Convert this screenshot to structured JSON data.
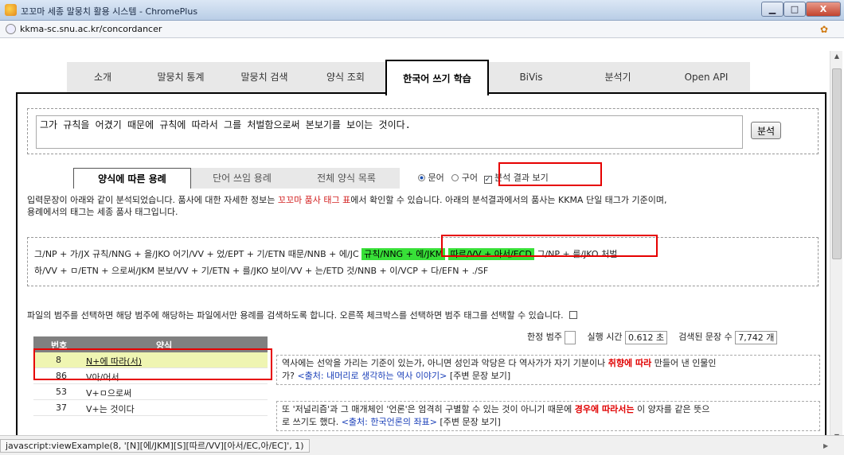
{
  "window": {
    "title": "꼬꼬마 세종 말뭉치 활용 시스템 - ChromePlus",
    "min_glyph": "▁",
    "max_glyph": "□",
    "close_glyph": "X"
  },
  "address": {
    "url": "kkma-sc.snu.ac.kr/concordancer"
  },
  "nav": {
    "tabs": [
      {
        "label": "소개"
      },
      {
        "label": "말뭉치 통계"
      },
      {
        "label": "말뭉치 검색"
      },
      {
        "label": "양식 조회"
      },
      {
        "label": "한국어 쓰기 학습",
        "active": true
      },
      {
        "label": "BiVis"
      },
      {
        "label": "분석기"
      },
      {
        "label": "Open API"
      }
    ]
  },
  "input": {
    "sentence": "그가 규칙을 어겼기 때문에 규칙에 따라서 그를 처벌함으로써 본보기를 보이는 것이다.",
    "analyze_label": "분석"
  },
  "subtabs": [
    {
      "label": "양식에 따른 용례",
      "active": true
    },
    {
      "label": "단어 쓰임 용례"
    },
    {
      "label": "전체 양식 목록"
    }
  ],
  "options": {
    "written": "문어",
    "spoken": "구어",
    "show_result": "분석 결과 보기",
    "selected": "written",
    "show_result_checked": true
  },
  "info": {
    "part1": "입력문장이 아래와 같이 분석되었습니다. 품사에 대한 자세한 정보는 ",
    "link": "꼬꼬마 품사 태그 표",
    "part2": "에서 확인할 수 있습니다. 아래의 분석결과에서의 품사는 KKMA 단일 태그가 기준이며,",
    "line2": "용례에서의 태그는 세종 품사 태그입니다."
  },
  "analysis": {
    "line1_a": "그/NP + 가/JX   규칙/NNG + 을/JKO   어기/VV + 었/EPT + 기/ETN   때문/NNB + 에/JC",
    "hl1": "규칙/NNG + 에/JKM",
    "hl2": "따르/VV + 아서/ECD",
    "line1_b": "그/NP + 를/JKO   처벌",
    "line2": "하/VV + ㅁ/ETN + 으로써/JKM   본보/VV + 기/ETN + 를/JKO   보이/VV + 는/ETD   것/NNB + 이/VCP + 다/EFN + ./SF"
  },
  "filter": {
    "text": "파일의 범주를 선택하면 해당 범주에 해당하는 파일에서만 용례를 검색하도록 합니다. 오른쪽 체크박스를 선택하면 범주 태그를 선택할 수 있습니다."
  },
  "meta": {
    "category_label": "한정 범주",
    "category_value": "",
    "time_label": "실행 시간",
    "time_value": "0.612 초",
    "count_label": "검색된 문장 수",
    "count_value": "7,742 개"
  },
  "table": {
    "headers": {
      "num": "번호",
      "pattern": "양식"
    },
    "rows": [
      {
        "num": "8",
        "pattern": "N+에 따라(서)",
        "selected": true
      },
      {
        "num": "86",
        "pattern": "V아/어서"
      },
      {
        "num": "53",
        "pattern": "V+ㅁ으로써"
      },
      {
        "num": "37",
        "pattern": "V+는 것이다"
      }
    ]
  },
  "examples": [
    {
      "pre": "역사에는 선악을 가리는 기준이 있는가, 아니면 성인과 악당은 다 역사가가 자기 기분이나 ",
      "kw": "취향에 따라",
      "post": " 만들어 낸 인물인",
      "line2_pre": "가? ",
      "src": "<출처: 내머리로 생각하는 역사 이야기>",
      "more": " [주변 문장 보기]"
    },
    {
      "pre": "또 '저널리즘'과 그 매개체인 '언론'은 엄격히 구별할 수 있는 것이 아니기 때문에 ",
      "kw": "경우에 따라서는",
      "post": " 이 양자를 같은 뜻으",
      "line2_pre": "로 쓰기도 했다. ",
      "src": "<출처: 한국언론의 좌표>",
      "more": " [주변 문장 보기]"
    }
  ],
  "status": {
    "text": "javascript:viewExample(8, '[N][에/JKM][S][따르/VV][아서/EC,아/EC]', 1)"
  }
}
